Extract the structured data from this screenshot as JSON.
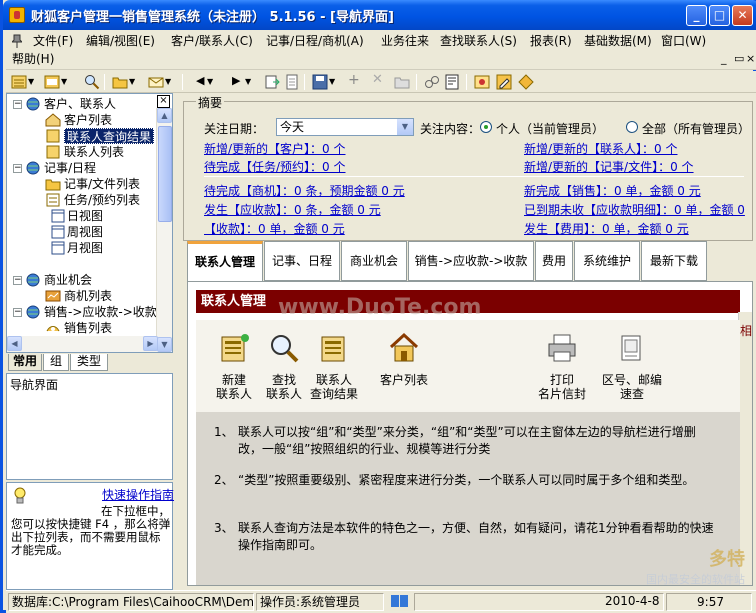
{
  "window": {
    "title": "财狐客户管理一销售管理系统（未注册） 5.1.56 - [导航界面]"
  },
  "menu": {
    "items": [
      "文件(F)",
      "编辑/视图(E)",
      "客户/联系人(C)",
      "记事/日程/商机(A)",
      "业务往来",
      "查找联系人(S)",
      "报表(R)",
      "基础数据(M)",
      "窗口(W)",
      "帮助(H)"
    ]
  },
  "tree": {
    "items": [
      {
        "label": "客户、联系人",
        "icon": "globe-icon"
      },
      {
        "label": "客户列表",
        "icon": "home-icon"
      },
      {
        "label": "联系人查询结果",
        "icon": "notebook-icon"
      },
      {
        "label": "联系人列表",
        "icon": "notebook-icon"
      },
      {
        "label": "记事/日程",
        "icon": "globe-icon"
      },
      {
        "label": "记事/文件列表",
        "icon": "folder-icon"
      },
      {
        "label": "任务/预约列表",
        "icon": "tasks-icon"
      },
      {
        "label": "日视图",
        "icon": "calendar-icon"
      },
      {
        "label": "周视图",
        "icon": "calendar-icon"
      },
      {
        "label": "月视图",
        "icon": "calendar-icon"
      },
      {
        "label": "商业机会",
        "icon": "globe-icon"
      },
      {
        "label": "商机列表",
        "icon": "opportunity-icon"
      },
      {
        "label": "销售->应收款->收款",
        "icon": "globe-icon"
      },
      {
        "label": "销售列表",
        "icon": "sales-icon"
      }
    ]
  },
  "left_tabs": [
    "常用",
    "组",
    "类型"
  ],
  "nav_pane": {
    "text": "导航界面"
  },
  "tip": {
    "link": "快速操作指南",
    "line1": "在下拉框中，",
    "line2": "您可以按快捷键 F4 ，那么将弹出下拉列表，而不需要用鼠标才能完成。"
  },
  "summary": {
    "legend": "摘要",
    "date_label": "关注日期：",
    "date_value": "今天",
    "focus_label": "关注内容：",
    "radio_personal": "个人（当前管理员）",
    "radio_all": "全部（所有管理员）",
    "links": {
      "new_clients": "新增/更新的【客户】：0 个",
      "new_contacts": "新增/更新的【联系人】：0 个",
      "tasks_done": "待完成【任务/预约】：0 个",
      "new_notes": "新增/更新的【记事/文件】：0 个",
      "opportunities": "待完成【商机】：0 条，预期金额 0 元",
      "new_sales": "新完成【销售】：0 单，金额 0 元",
      "receivables": "发生【应收款】：0 条，金额 0 元",
      "overdue": "已到期未收【应收款明细】：0 单，金额 0",
      "received": "【收款】：0 单，金额 0 元",
      "expenses": "发生【费用】：0 单，金额 0 元"
    }
  },
  "module_tabs": [
    "联系人管理",
    "记事、日程",
    "商业机会",
    "销售->应收款->收款",
    "费用",
    "系统维护",
    "最新下载"
  ],
  "content": {
    "header": "联系人管理",
    "side_char": "相",
    "actions": [
      {
        "line1": "新建",
        "line2": "联系人",
        "icon": "new-contact-icon"
      },
      {
        "line1": "查找",
        "line2": "联系人",
        "icon": "search-icon"
      },
      {
        "line1": "联系人",
        "line2": "查询结果",
        "icon": "query-result-icon"
      },
      {
        "line1": "客户列表",
        "line2": "",
        "icon": "home-icon"
      },
      {
        "line1": "打印",
        "line2": "名片信封",
        "icon": "printer-icon"
      },
      {
        "line1": "区号、邮编",
        "line2": "速查",
        "icon": "lookup-icon"
      }
    ],
    "paragraphs": [
      {
        "num": "1、",
        "text": "联系人可以按“组”和“类型”来分类，“组”和“类型”可以在主窗体左边的导航栏进行增删改，一般“组”按照组织的行业、规模等进行分类"
      },
      {
        "num": "2、",
        "text": "“类型”按照重要级别、紧密程度来进行分类，一个联系人可以同时属于多个组和类型。"
      },
      {
        "num": "3、",
        "text": "联系人查询方法是本软件的特色之一，方便、自然，如有疑问，请花1分钟看看帮助的快速操作指南即可。"
      }
    ]
  },
  "statusbar": {
    "db": "数据库:C:\\Program Files\\CaihooCRM\\Demo.c",
    "operator": "操作员:系统管理员",
    "date": "2010-4-8",
    "time": "9:57"
  },
  "watermark": "www.DuoTe.com",
  "watermark2": {
    "big": "多特",
    "small": "国内最安全的软件站"
  },
  "colors": {
    "title_blue": "#0054E3",
    "header_red": "#7B0000",
    "link_blue": "#0000CC",
    "tab_accent": "#F0A33C"
  }
}
